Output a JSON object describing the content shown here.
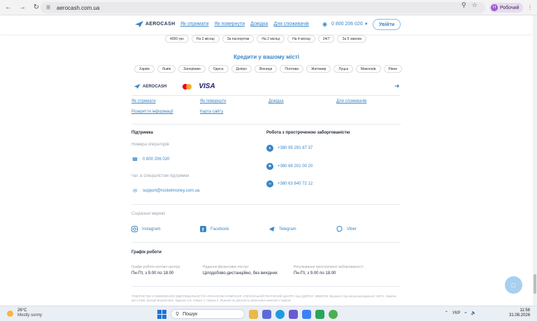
{
  "browser": {
    "url": "aerocash.com.ua",
    "profile_initial": "Н",
    "profile_label": "Робочий"
  },
  "header": {
    "logo": "AEROCASH",
    "nav": [
      "Як отримати",
      "Як повернути",
      "Довідка",
      "Для споживачів"
    ],
    "phone": "0 800 206 020",
    "login_label": "Увійти"
  },
  "chips_top": [
    "4000 грн",
    "На 3 місяці",
    "За паспортом",
    "На 2 місяці",
    "На 4 місяці",
    "24/7",
    "За 5 хвилин"
  ],
  "cities": {
    "title": "Кредити у вашому місті",
    "items": [
      "Харків",
      "Львів",
      "Запоріжжя",
      "Одеса",
      "Дніпро",
      "Вінниця",
      "Полтава",
      "Житомир",
      "Луцьк",
      "Миколаїв",
      "Рівне"
    ]
  },
  "footer": {
    "logo": "AEROCASH",
    "visa": "VISA",
    "links": [
      "Як отримати",
      "Як повернути",
      "Довідка",
      "Для споживачів",
      "Розкриття інформації",
      "Карта сайту"
    ],
    "support": {
      "title": "Підтримка",
      "operators_label": "Номера операторів",
      "phone": "0 800 206 020",
      "chat_label": "Чат зі спеціалістом підтримки",
      "email": "support@rocketmoney.com.ua"
    },
    "overdue": {
      "title": "Робота з простроченою заборгованістю",
      "phones": [
        "+380 95 291 87 37",
        "+380 68 201 00 20",
        "+380 63 840 72 12"
      ]
    },
    "social": {
      "label": "Соціальні мережі",
      "items": [
        "Instagram",
        "Facebook",
        "Telegram",
        "Viber"
      ]
    },
    "schedule": {
      "title": "Графік роботи",
      "cols": [
        {
          "label": "Графік роботи контакт-центру:",
          "value": "Пн-Пт, з 9.00 по 18.00"
        },
        {
          "label": "Надання фінансових послуг:",
          "value": "Цілодобово-дистанційно, без вихідних"
        },
        {
          "label": "Регулювання простроченої заборгованості:",
          "value": "Пн-Пт, з 9.00 по 18.00"
        }
      ]
    },
    "legal": "ТОВАРИСТВО З ОБМЕЖЕНОЮ ВІДПОВІДАЛЬНІСТЮ «ФІНАНСОВА КОМПАНІЯ «УКРАЇНСЬКИЙ ПЛАТІЖНИЙ ЦЕНТР» Код ЄДРПОУ: 39888755. Відомості про місцезнаходження: 04071, Україна, місто Київ, вулиця Верхній Вал, будинок 4-Б, поверх 1, поверх 2. Ліцензія на діяльність фінансової компанії з правом"
  },
  "taskbar": {
    "temp": "26°C",
    "weather": "Mostly sunny",
    "search": "Пошук",
    "lang": "УКР",
    "time": "11:58",
    "date": "31.08.2026"
  }
}
